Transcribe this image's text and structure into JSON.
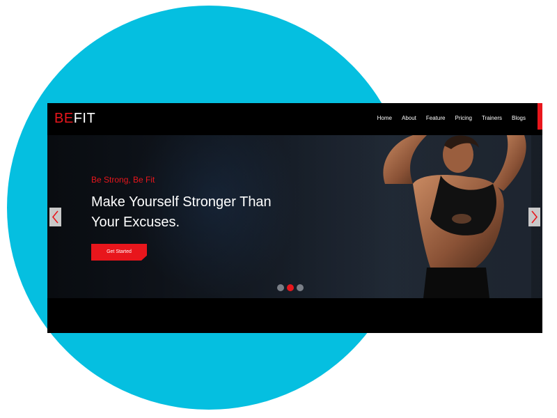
{
  "logo": {
    "part1": "BE",
    "part2": "FIT"
  },
  "nav": {
    "items": [
      {
        "label": "Home"
      },
      {
        "label": "About"
      },
      {
        "label": "Feature"
      },
      {
        "label": "Pricing"
      },
      {
        "label": "Trainers"
      },
      {
        "label": "Blogs"
      }
    ]
  },
  "hero": {
    "tagline": "Be Strong, Be Fit",
    "headline_line1": "Make Yourself Stronger Than",
    "headline_line2": "Your Excuses.",
    "cta_label": "Get Started",
    "slides_total": 3,
    "active_slide": 2
  },
  "icons": {
    "prev": "chevron-left-icon",
    "next": "chevron-right-icon"
  },
  "colors": {
    "accent": "#e8161c",
    "background_circle": "#05bfe0",
    "site_background": "#000000"
  }
}
